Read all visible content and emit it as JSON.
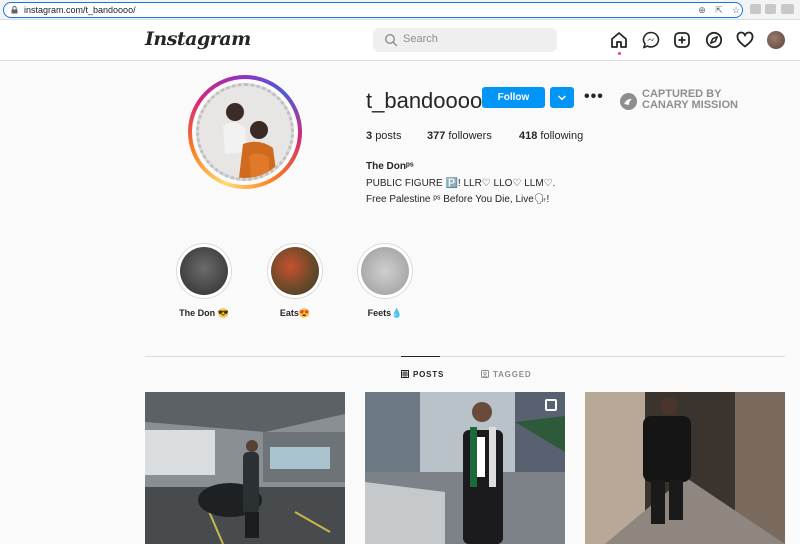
{
  "browser": {
    "url": "instagram.com/t_bandoooo/"
  },
  "header": {
    "logo": "Instagram",
    "search_placeholder": "Search"
  },
  "profile": {
    "username": "t_bandoooo",
    "follow_label": "Follow",
    "stats": {
      "posts_count": "3",
      "posts_label": "posts",
      "followers_count": "377",
      "followers_label": "followers",
      "following_count": "418",
      "following_label": "following"
    },
    "full_name": "The Donᵖˢ",
    "bio_lines": [
      "PUBLIC FIGURE 🅿️! LLR♡ LLO♡ LLM♡.",
      "Free Palestine ᵖˢ Before You Die, Live🗣!"
    ]
  },
  "watermark": {
    "line1": "CAPTURED BY",
    "line2": "CANARY MISSION"
  },
  "highlights": [
    {
      "label": "The Don 😎"
    },
    {
      "label": "Eats😍"
    },
    {
      "label": "Feets💧"
    }
  ],
  "tabs": [
    {
      "label": "POSTS",
      "active": true
    },
    {
      "label": "TAGGED",
      "active": false
    }
  ],
  "colors": {
    "accent": "#0095f6",
    "notification": "#ed4956"
  }
}
